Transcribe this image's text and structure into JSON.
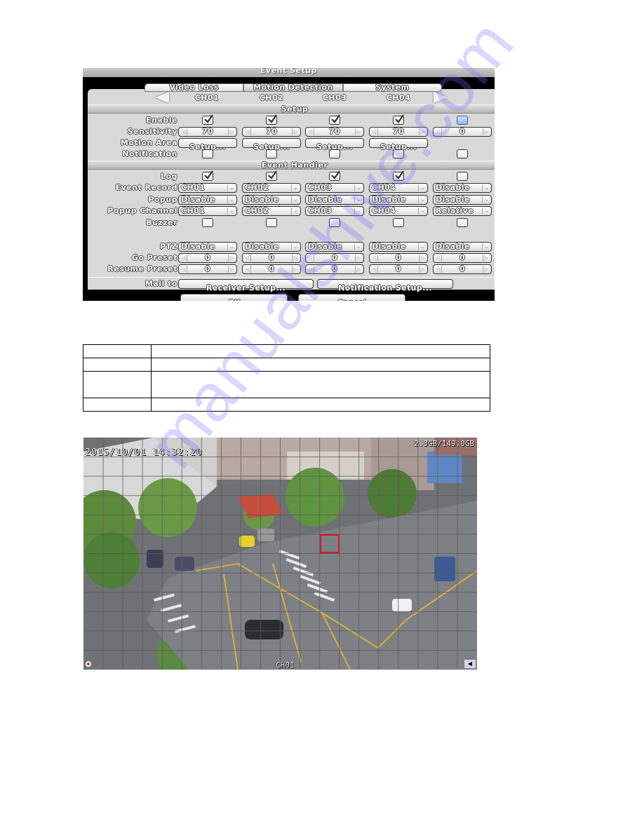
{
  "dialog": {
    "title": "Event Setup",
    "tabs": [
      {
        "label": "Video Loss",
        "active": false
      },
      {
        "label": "Motion Detection",
        "active": true
      },
      {
        "label": "System",
        "active": false
      }
    ],
    "channels": [
      "CH01",
      "CH02",
      "CH03",
      "CH04"
    ],
    "sections": {
      "setup": "Setup",
      "event_handler": "Event Handler"
    },
    "rows": {
      "enable": {
        "label": "Enable",
        "values": [
          true,
          true,
          true,
          true,
          false
        ],
        "last_highlighted": true
      },
      "sensitivity": {
        "label": "Sensitivity",
        "values": [
          "70",
          "70",
          "70",
          "70",
          "0"
        ]
      },
      "motion_area": {
        "label": "Motion Area",
        "button_label": "Setup...",
        "count": 4
      },
      "notification": {
        "label": "Notification",
        "values": [
          false,
          false,
          false,
          false,
          false
        ]
      },
      "log": {
        "label": "Log",
        "values": [
          true,
          true,
          true,
          true,
          false
        ]
      },
      "event_record": {
        "label": "Event Record",
        "values": [
          "CH01",
          "CH02",
          "CH03",
          "CH04",
          "Disable"
        ]
      },
      "popup": {
        "label": "Popup",
        "values": [
          "Disable",
          "Disable",
          "Disable",
          "Disable",
          "Disable"
        ]
      },
      "popup_channel": {
        "label": "Popup Channel",
        "values": [
          "CH01",
          "CH02",
          "CH03",
          "CH04",
          "Relative"
        ]
      },
      "buzzer": {
        "label": "Buzzer",
        "values": [
          false,
          false,
          false,
          false,
          false
        ]
      },
      "ptz": {
        "label": "PTZ",
        "values": [
          "Disable",
          "Disable",
          "Disable",
          "Disable",
          "Disable"
        ]
      },
      "go_preset": {
        "label": "Go Preset",
        "values": [
          "0",
          "0",
          "0",
          "0",
          "0"
        ]
      },
      "resume_preset": {
        "label": "Resume Preset",
        "values": [
          "0",
          "0",
          "0",
          "0",
          "0"
        ]
      }
    },
    "mail_to": {
      "label": "Mail to",
      "receiver_button": "Receiver Setup...",
      "notification_button": "Notification Setup..."
    },
    "ok_label": "OK",
    "cancel_label": "Cancel"
  },
  "table": {
    "rows": [
      [
        "",
        ""
      ],
      [
        "",
        ""
      ],
      [
        "",
        ""
      ],
      [
        "",
        ""
      ]
    ]
  },
  "camera": {
    "timestamp": "2015/10/01  14:32:20",
    "disk_usage": "2.3GB/149.0GB",
    "channel_label": "CH01",
    "motion_grid": {
      "columns": 20,
      "rows": 12
    },
    "motion_cell": {
      "column": 12,
      "row": 5
    }
  },
  "watermark": "manualshive.com"
}
